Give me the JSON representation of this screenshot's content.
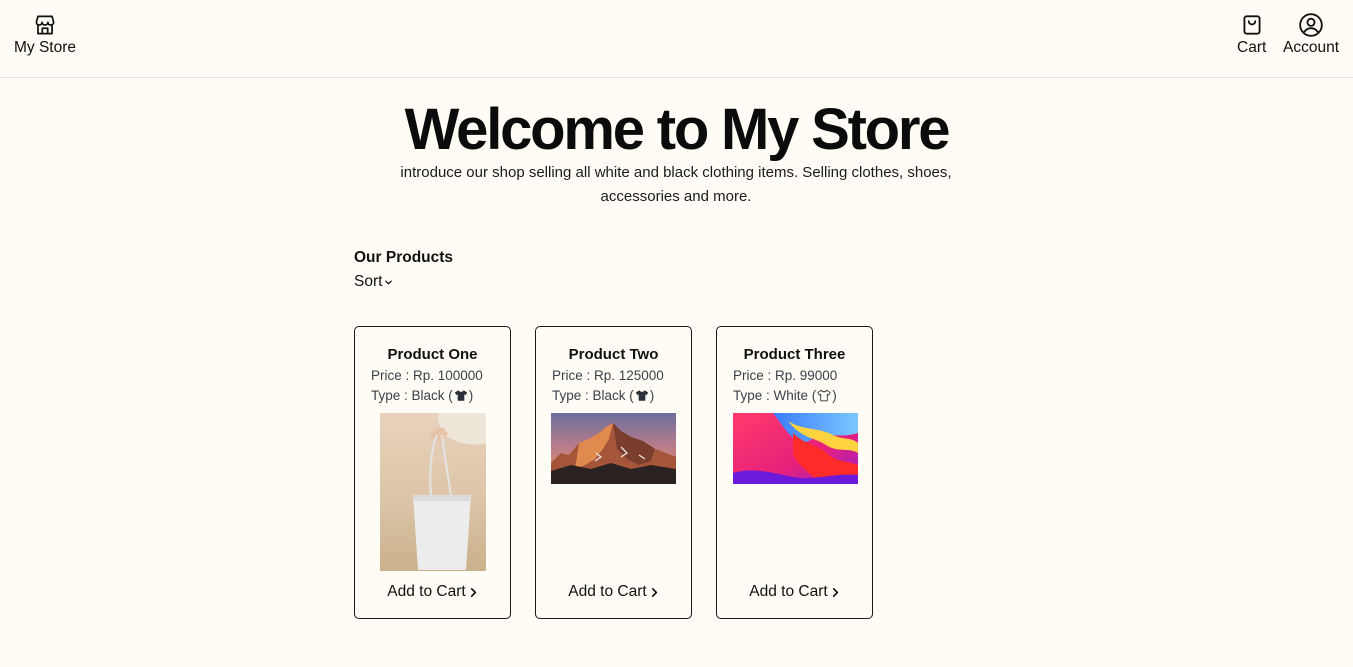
{
  "nav": {
    "store_label": "My Store",
    "cart_label": "Cart",
    "account_label": "Account"
  },
  "hero": {
    "title": "Welcome to My Store",
    "subtitle": "introduce our shop selling all white and black clothing items. Selling clothes, shoes, accessories and more."
  },
  "products_section": {
    "title": "Our Products",
    "sort_label": "Sort"
  },
  "products": [
    {
      "name": "Product One",
      "price": "Price : Rp. 100000",
      "type_prefix": "Type : Black (",
      "type_suffix": ")",
      "type_icon": "black-shirt-icon",
      "image": "tote-bag",
      "add_label": "Add to Cart"
    },
    {
      "name": "Product Two",
      "price": "Price : Rp. 125000",
      "type_prefix": "Type : Black (",
      "type_suffix": ")",
      "type_icon": "black-shirt-icon",
      "image": "mountain-sunset",
      "add_label": "Add to Cart"
    },
    {
      "name": "Product Three",
      "price": "Price : Rp. 99000",
      "type_prefix": "Type : White (",
      "type_suffix": ")",
      "type_icon": "white-shirt-icon",
      "image": "abstract-gradient",
      "add_label": "Add to Cart"
    }
  ],
  "colors": {
    "background": "#fefcf4",
    "text": "#111111",
    "muted_text": "#3a3f4a",
    "card_border": "#1a1a1a"
  }
}
